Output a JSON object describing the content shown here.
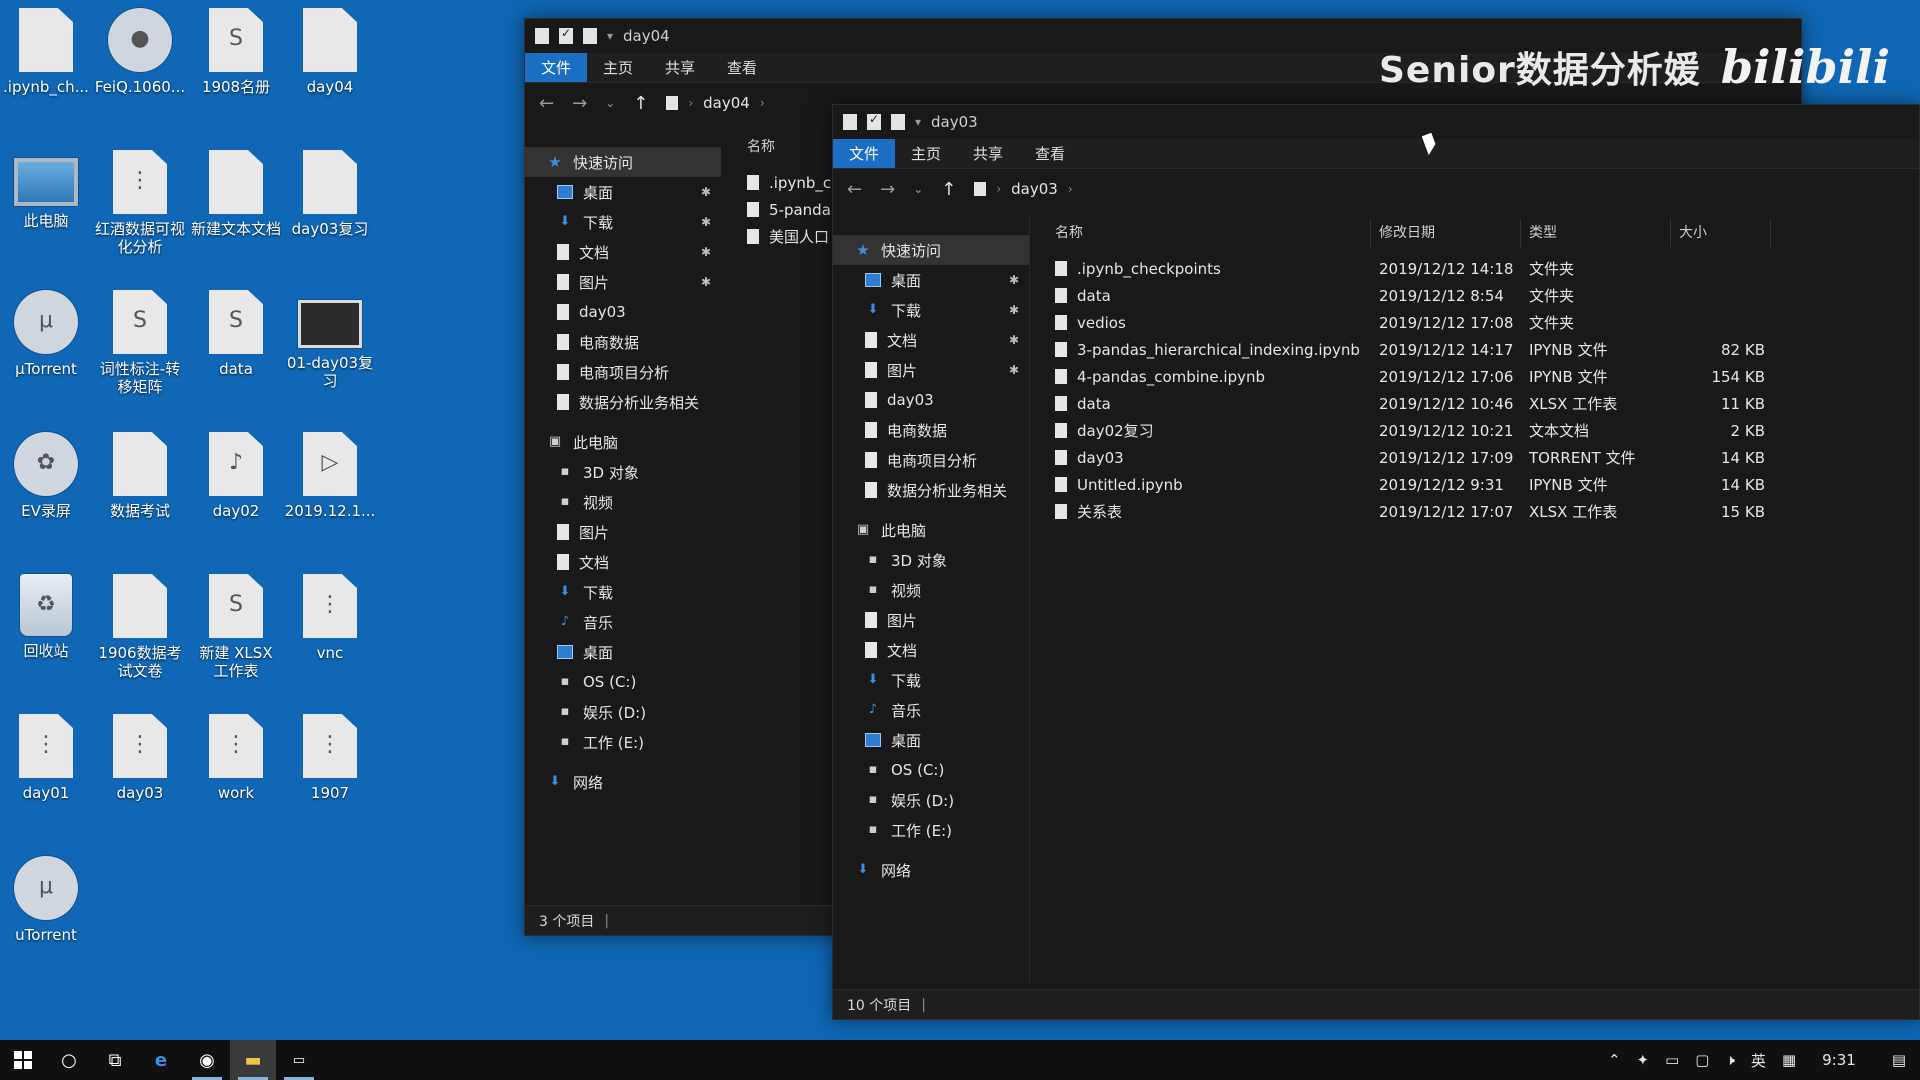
{
  "desktop": {
    "icons": [
      {
        "label": ".ipynb_ch...",
        "icon": "file-icon",
        "glyph": ""
      },
      {
        "label": "FeiQ.1060...",
        "icon": "feiq-icon",
        "glyph": "●"
      },
      {
        "label": "1908名册",
        "icon": "wps-sheet-icon",
        "glyph": "S"
      },
      {
        "label": "day04",
        "icon": "file-icon",
        "glyph": ""
      },
      {
        "label": "此电脑",
        "icon": "computer-icon",
        "glyph": ""
      },
      {
        "label": "红酒数据可视化分析",
        "icon": "file-icon",
        "glyph": "⋮"
      },
      {
        "label": "新建文本文档",
        "icon": "file-icon",
        "glyph": ""
      },
      {
        "label": "day03复习",
        "icon": "file-icon",
        "glyph": ""
      },
      {
        "label": "μTorrent",
        "icon": "utorrent-icon",
        "glyph": "μ"
      },
      {
        "label": "词性标注-转移矩阵",
        "icon": "wps-doc-icon",
        "glyph": "S"
      },
      {
        "label": "data",
        "icon": "wps-sheet-icon",
        "glyph": "S"
      },
      {
        "label": "01-day03复习",
        "icon": "video-icon",
        "glyph": ""
      },
      {
        "label": "EV录屏",
        "icon": "ev-recorder-icon",
        "glyph": "✿"
      },
      {
        "label": "数据考试",
        "icon": "file-icon",
        "glyph": ""
      },
      {
        "label": "day02",
        "icon": "file-icon",
        "glyph": "♪"
      },
      {
        "label": "2019.12.1...",
        "icon": "mp4-icon",
        "glyph": "▷"
      },
      {
        "label": "回收站",
        "icon": "recycle-bin-icon",
        "glyph": "♻"
      },
      {
        "label": "1906数据考试文卷",
        "icon": "file-icon",
        "glyph": ""
      },
      {
        "label": "新建 XLSX 工作表",
        "icon": "wps-sheet-icon",
        "glyph": "S"
      },
      {
        "label": "vnc",
        "icon": "file-icon",
        "glyph": "⋮"
      },
      {
        "label": "day01",
        "icon": "file-icon",
        "glyph": "⋮"
      },
      {
        "label": "day03",
        "icon": "file-icon",
        "glyph": "⋮"
      },
      {
        "label": "work",
        "icon": "file-icon",
        "glyph": "⋮"
      },
      {
        "label": "1907",
        "icon": "file-icon",
        "glyph": "⋮"
      },
      {
        "label": "uTorrent",
        "icon": "utorrent-icon",
        "glyph": "μ"
      }
    ]
  },
  "watermark": {
    "text": "Senior数据分析媛",
    "logo": "bilibili"
  },
  "win_back": {
    "title": "day04",
    "tabs": [
      "文件",
      "主页",
      "共享",
      "查看"
    ],
    "breadcrumb": "day04",
    "nav": [
      "快速访问",
      "桌面",
      "下载",
      "文档",
      "图片",
      "day03",
      "电商数据",
      "电商项目分析",
      "数据分析业务相关",
      "此电脑",
      "3D 对象",
      "视频",
      "图片",
      "文档",
      "下载",
      "音乐",
      "桌面",
      "OS (C:)",
      "娱乐 (D:)",
      "工作 (E:)",
      "网络"
    ],
    "col_name": "名称",
    "files": [
      ".ipynb_c",
      "5-panda",
      "美国人口"
    ],
    "status": "3 个项目"
  },
  "win_front": {
    "title": "day03",
    "tabs": [
      "文件",
      "主页",
      "共享",
      "查看"
    ],
    "breadcrumb": "day03",
    "nav": [
      "快速访问",
      "桌面",
      "下载",
      "文档",
      "图片",
      "day03",
      "电商数据",
      "电商项目分析",
      "数据分析业务相关",
      "此电脑",
      "3D 对象",
      "视频",
      "图片",
      "文档",
      "下载",
      "音乐",
      "桌面",
      "OS (C:)",
      "娱乐 (D:)",
      "工作 (E:)",
      "网络"
    ],
    "columns": [
      "名称",
      "修改日期",
      "类型",
      "大小"
    ],
    "files": [
      {
        "name": ".ipynb_checkpoints",
        "date": "2019/12/12 14:18",
        "type": "文件夹",
        "size": ""
      },
      {
        "name": "data",
        "date": "2019/12/12 8:54",
        "type": "文件夹",
        "size": ""
      },
      {
        "name": "vedios",
        "date": "2019/12/12 17:08",
        "type": "文件夹",
        "size": ""
      },
      {
        "name": "3-pandas_hierarchical_indexing.ipynb",
        "date": "2019/12/12 14:17",
        "type": "IPYNB 文件",
        "size": "82 KB"
      },
      {
        "name": "4-pandas_combine.ipynb",
        "date": "2019/12/12 17:06",
        "type": "IPYNB 文件",
        "size": "154 KB"
      },
      {
        "name": "data",
        "date": "2019/12/12 10:46",
        "type": "XLSX 工作表",
        "size": "11 KB"
      },
      {
        "name": "day02复习",
        "date": "2019/12/12 10:21",
        "type": "文本文档",
        "size": "2 KB"
      },
      {
        "name": "day03",
        "date": "2019/12/12 17:09",
        "type": "TORRENT 文件",
        "size": "14 KB"
      },
      {
        "name": "Untitled.ipynb",
        "date": "2019/12/12 9:31",
        "type": "IPYNB 文件",
        "size": "14 KB"
      },
      {
        "name": "关系表",
        "date": "2019/12/12 17:07",
        "type": "XLSX 工作表",
        "size": "15 KB"
      }
    ],
    "status": "10 个项目"
  },
  "taskbar": {
    "clock": "9:31",
    "ime": "英"
  }
}
